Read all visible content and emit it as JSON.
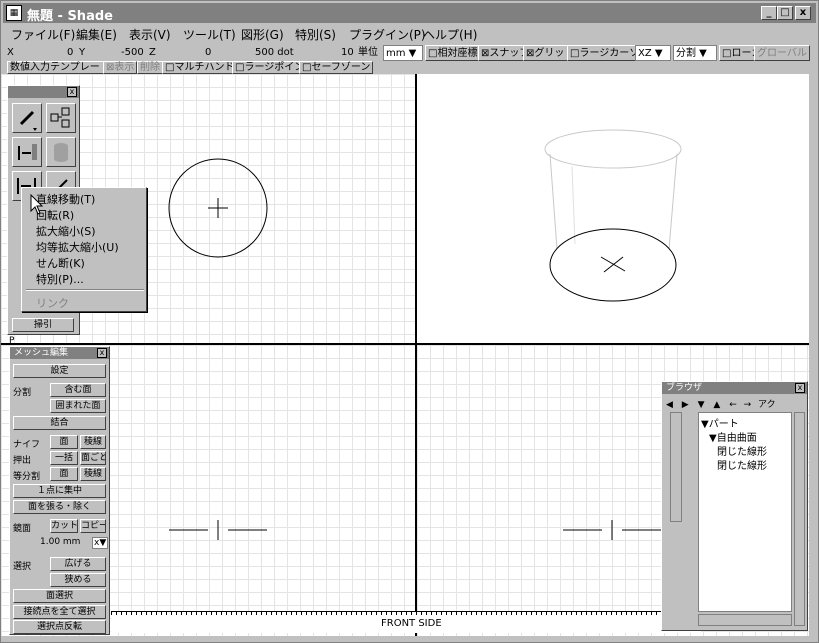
{
  "window": {
    "title": "無題 - Shade",
    "min": "_",
    "max": "□",
    "close": "x"
  },
  "menus": [
    "ファイル(F)",
    "編集(E)",
    "表示(V)",
    "ツール(T)",
    "図形(G)",
    "特別(S)",
    "プラグイン(P)",
    "ヘルプ(H)"
  ],
  "status": {
    "x_label": "X",
    "x_val": "0",
    "y_label": "Y",
    "y_val": "-500",
    "z_label": "Z",
    "z_val": "0",
    "dot": "500 dot",
    "ten": "10",
    "unit_label": "単位",
    "unit": "mm",
    "rel_coord": "□相対座標",
    "snap": "⊠スナップ",
    "grid": "⊠グリッド",
    "large_cursor": "□ラージカーソル",
    "plane": "XZ",
    "split": "分割",
    "local": "□ローカル",
    "global": "グローバル"
  },
  "toolbar2": {
    "num_template": "数値入力テンプレート",
    "display": "⊠表示",
    "delete": "削除",
    "multi_handle": "□マルチハンドル",
    "large_point": "□ラージポイント",
    "safe_zone": "□セーフゾーン"
  },
  "tool_palette": {
    "close": "x",
    "sweep_label": "掃引"
  },
  "popup_menu": {
    "items": [
      "直線移動(T)",
      "回転(R)",
      "拡大縮小(S)",
      "均等拡大縮小(U)",
      "せん断(K)",
      "特別(P)..."
    ],
    "link": "リンク"
  },
  "mesh_panel": {
    "title": "メッシュ編集",
    "setting": "設定",
    "split_label": "分割",
    "include_face": "含む面",
    "enclosed_face": "囲まれた面",
    "join": "結合",
    "knife_label": "ナイフ",
    "face": "面",
    "edge": "稜線",
    "extrude_label": "押出",
    "batch": "一括",
    "per_face": "面ごと",
    "equal_label": "等分割",
    "face2": "面",
    "edge2": "稜線",
    "collapse": "１点に集中",
    "fill_face": "面を張る・除く",
    "mirror_label": "鏡面",
    "cut": "カット",
    "copy": "コピー",
    "mm_value": "1.00 mm",
    "axis": "x",
    "select_label": "選択",
    "expand": "広げる",
    "shrink": "狭める",
    "face_select": "面選択",
    "select_all_connected": "接続点を全て選択",
    "invert_select": "選択点反転"
  },
  "browser": {
    "title": "ブラウザ",
    "tab": "アク",
    "part": "▼パート",
    "free_surface": "▼自由曲面",
    "closed_line1": "閉じた線形",
    "closed_line2": "閉じた線形"
  },
  "viewport": {
    "label_bottom": "FRONT SIDE",
    "p_label": "P"
  }
}
